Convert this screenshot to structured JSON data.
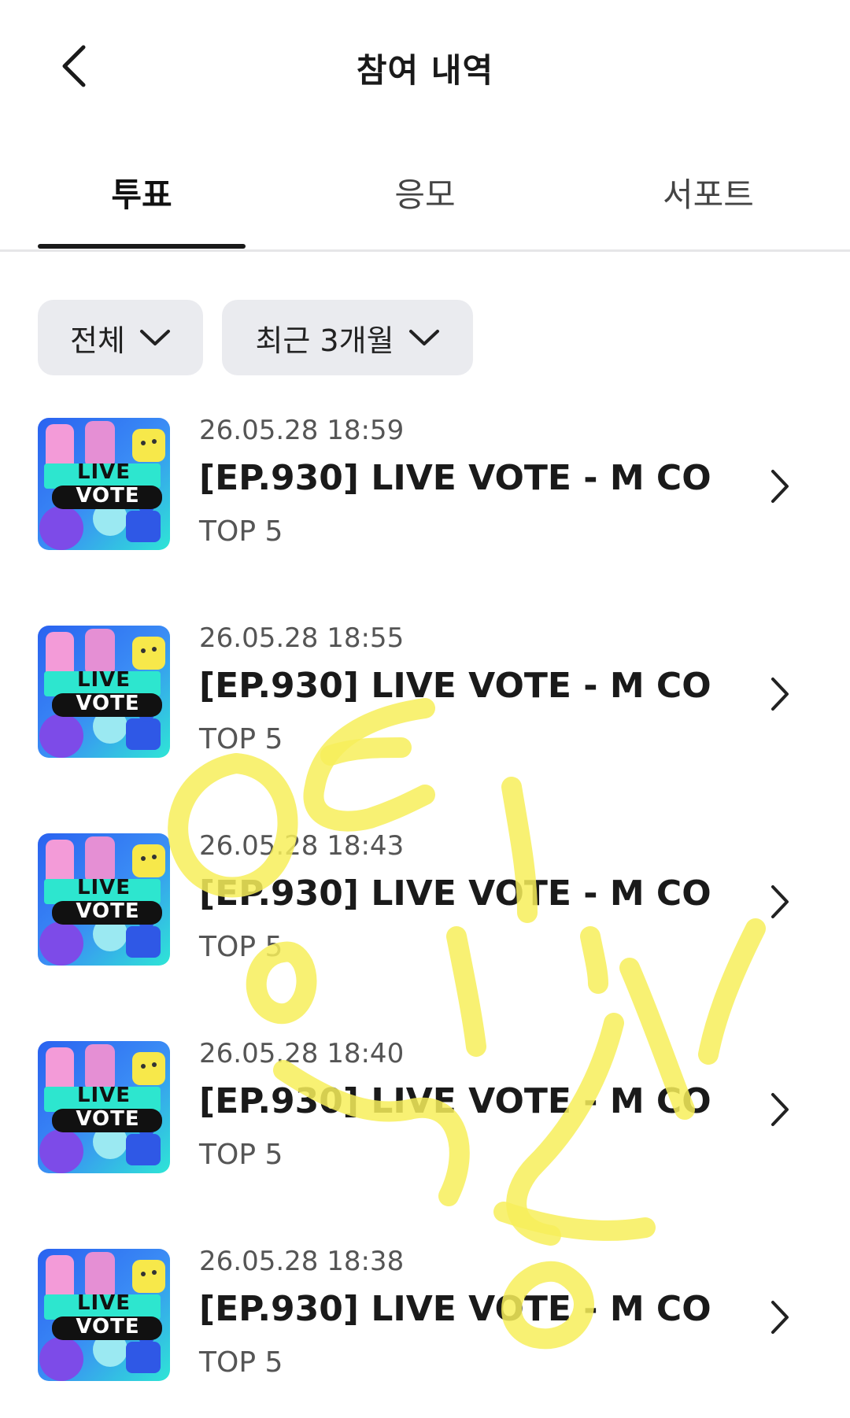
{
  "header": {
    "title": "참여 내역",
    "back_icon": "chevron-left-icon"
  },
  "tabs": [
    {
      "label": "투표",
      "active": true
    },
    {
      "label": "응모",
      "active": false
    },
    {
      "label": "서포트",
      "active": false
    }
  ],
  "filters": {
    "category": "전체",
    "period": "최근 3개월"
  },
  "items": [
    {
      "date": "26.05.28 18:59",
      "title": "[EP.930] LIVE VOTE - M CO...",
      "subtitle": "TOP 5",
      "thumb_line1": "LIVE",
      "thumb_line2": "VOTE"
    },
    {
      "date": "26.05.28 18:55",
      "title": "[EP.930] LIVE VOTE - M CO...",
      "subtitle": "TOP 5",
      "thumb_line1": "LIVE",
      "thumb_line2": "VOTE"
    },
    {
      "date": "26.05.28 18:43",
      "title": "[EP.930] LIVE VOTE - M CO...",
      "subtitle": "TOP 5",
      "thumb_line1": "LIVE",
      "thumb_line2": "VOTE"
    },
    {
      "date": "26.05.28 18:40",
      "title": "[EP.930] LIVE VOTE - M CO...",
      "subtitle": "TOP 5",
      "thumb_line1": "LIVE",
      "thumb_line2": "VOTE"
    },
    {
      "date": "26.05.28 18:38",
      "title": "[EP.930] LIVE VOTE - M CO...",
      "subtitle": "TOP 5",
      "thumb_line1": "LIVE",
      "thumb_line2": "VOTE"
    }
  ],
  "overlay": {
    "description_icon": "handwritten-scribble",
    "color": "#f7ef5a"
  },
  "colors": {
    "accent": "#1a1a1a",
    "filter_bg": "#eaebef",
    "divider": "#e6e6e8",
    "thumb_cyan": "#2ee6d6",
    "thumb_blue": "#2a62f0",
    "thumb_pink": "#f39bd8",
    "thumb_yellow": "#f7e84a"
  }
}
